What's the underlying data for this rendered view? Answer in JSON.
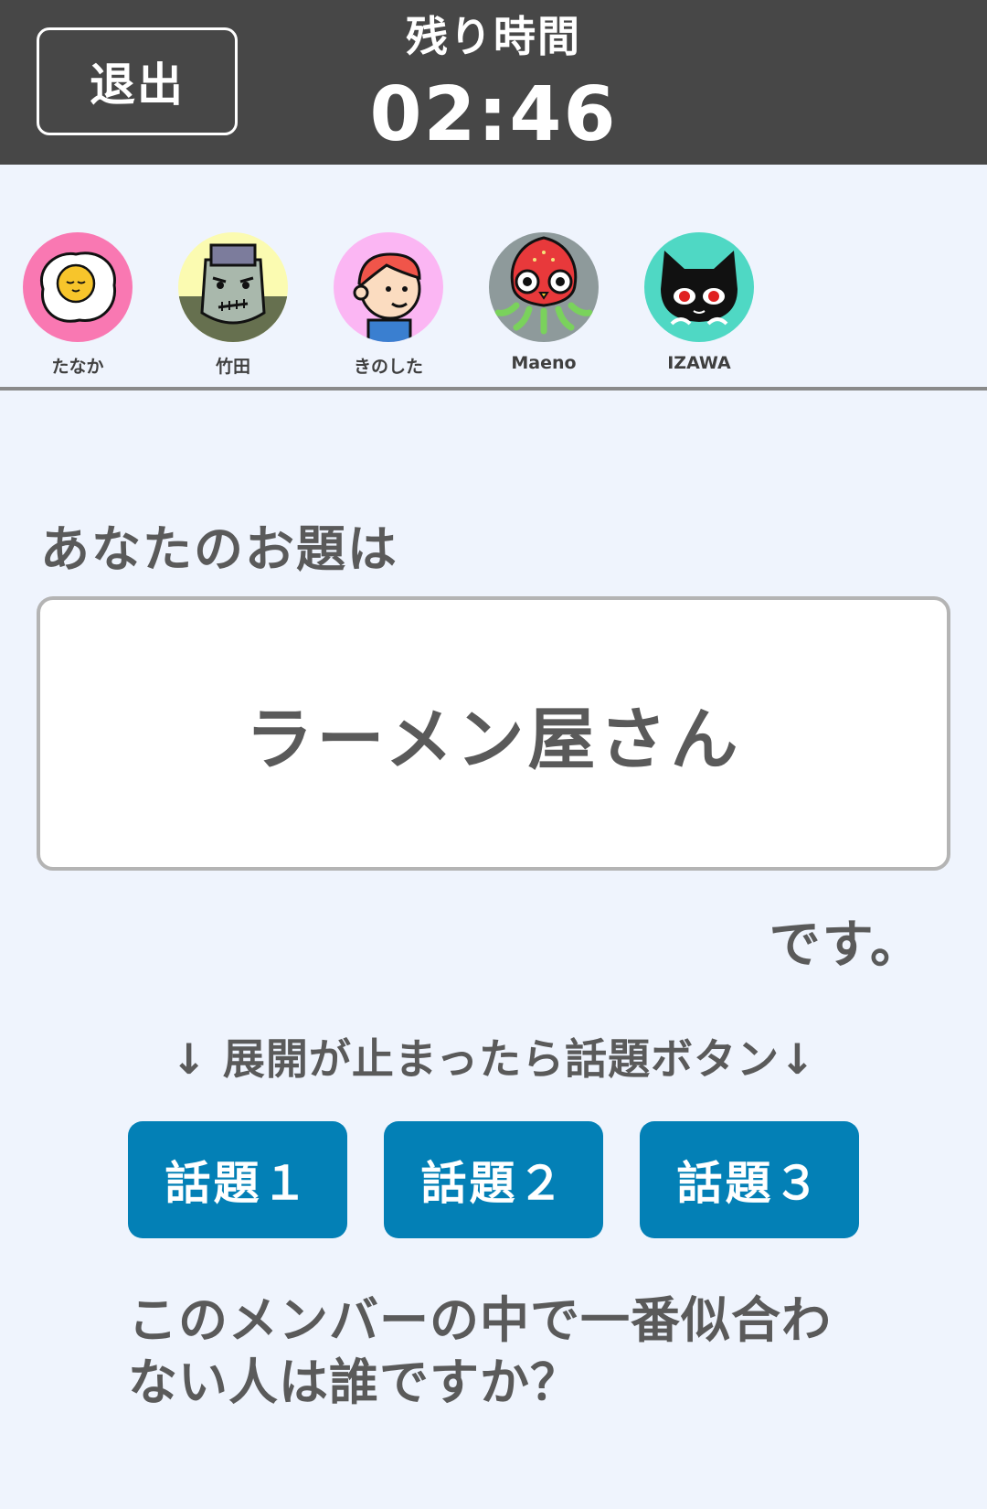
{
  "header": {
    "exit_label": "退出",
    "timer_label": "残り時間",
    "timer_value": "02:46"
  },
  "players": [
    {
      "name": "たなか",
      "icon": "fried-egg-icon",
      "bg": "#f978b2"
    },
    {
      "name": "竹田",
      "icon": "zombie-icon",
      "bg": "#fbfbb1"
    },
    {
      "name": "きのした",
      "icon": "boy-icon",
      "bg": "#fbb6f3"
    },
    {
      "name": "Maeno",
      "icon": "strawberry-octopus-icon",
      "bg": "#8e9a9b"
    },
    {
      "name": "IZAWA",
      "icon": "black-cat-icon",
      "bg": "#4fd8c4"
    }
  ],
  "main": {
    "prompt_label": "あなたのお題は",
    "topic": "ラーメン屋さん",
    "suffix": "です。",
    "hint": "↓ 展開が止まったら話題ボタン↓",
    "buttons": [
      "話題１",
      "話題２",
      "話題３"
    ],
    "question": "このメンバーの中で一番似合わない人は誰ですか？"
  },
  "colors": {
    "header_bg": "#474747",
    "page_bg": "#eff4fd",
    "button_bg": "#0380b6",
    "text": "#5a5a5a"
  }
}
